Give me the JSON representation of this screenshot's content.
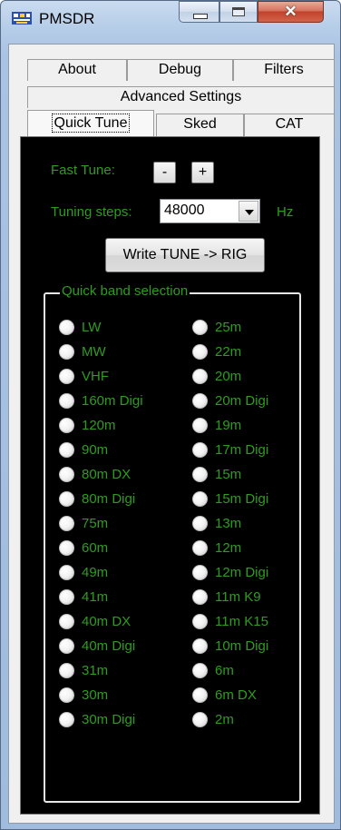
{
  "window": {
    "title": "PMSDR"
  },
  "tabs": {
    "row1": [
      "About",
      "Debug",
      "Filters"
    ],
    "row2": [
      "Advanced Settings"
    ],
    "row3": [
      "Quick Tune",
      "Sked",
      "CAT"
    ],
    "selected": "Quick Tune"
  },
  "quick_tune": {
    "fast_tune_label": "Fast Tune:",
    "minus_label": "-",
    "plus_label": "+",
    "tuning_steps_label": "Tuning steps:",
    "tuning_steps_value": "48000",
    "hz_label": "Hz",
    "write_button": "Write TUNE -> RIG",
    "band_group_title": "Quick band selection",
    "bands_left": [
      "LW",
      "MW",
      "VHF",
      "160m Digi",
      "120m",
      "90m",
      "80m DX",
      "80m Digi",
      "75m",
      "60m",
      "49m",
      "41m",
      "40m DX",
      "40m Digi",
      "31m",
      "30m",
      "30m Digi"
    ],
    "bands_right": [
      "25m",
      "22m",
      "20m",
      "20m Digi",
      "19m",
      "17m Digi",
      "15m",
      "15m Digi",
      "13m",
      "12m",
      "12m Digi",
      "11m K9",
      "11m K15",
      "10m Digi",
      "6m",
      "6m DX",
      "2m"
    ]
  },
  "colors": {
    "label_green": "#2f9c1f",
    "panel_bg": "#000000"
  }
}
